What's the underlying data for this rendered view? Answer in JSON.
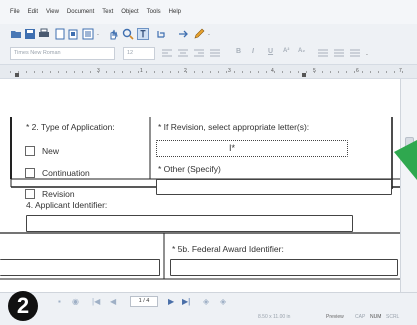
{
  "menu": [
    "File",
    "Edit",
    "View",
    "Document",
    "Text",
    "Object",
    "Tools",
    "Help"
  ],
  "toolbar": {
    "font_name": "Times New Roman",
    "font_size": "12",
    "bold": "B",
    "italic": "I",
    "underline": "U"
  },
  "ruler": [
    "3",
    "1",
    "2",
    "3",
    "4",
    "5",
    "6",
    "7"
  ],
  "form": {
    "type_of_application_label": "* 2. Type of Application:",
    "revision_letter_label": "* If Revision, select appropriate letter(s):",
    "option_new": "New",
    "option_continuation": "Continuation",
    "option_revision": "Revision",
    "other_specify_label": "* Other (Specify)",
    "applicant_identifier_label": "4. Applicant Identifier:",
    "federal_award_identifier_label": "* 5b. Federal Award Identifier:"
  },
  "nav": {
    "page_indicator": "1 / 4"
  },
  "status": {
    "page_size": "8.50 x 11.00 in",
    "mode": "Preview",
    "cap": "CAP",
    "num": "NUM",
    "scrl": "SCRL"
  },
  "badge": "2",
  "colors": {
    "accent_green": "#2fa84f",
    "window_bg": "#eef1f5"
  }
}
